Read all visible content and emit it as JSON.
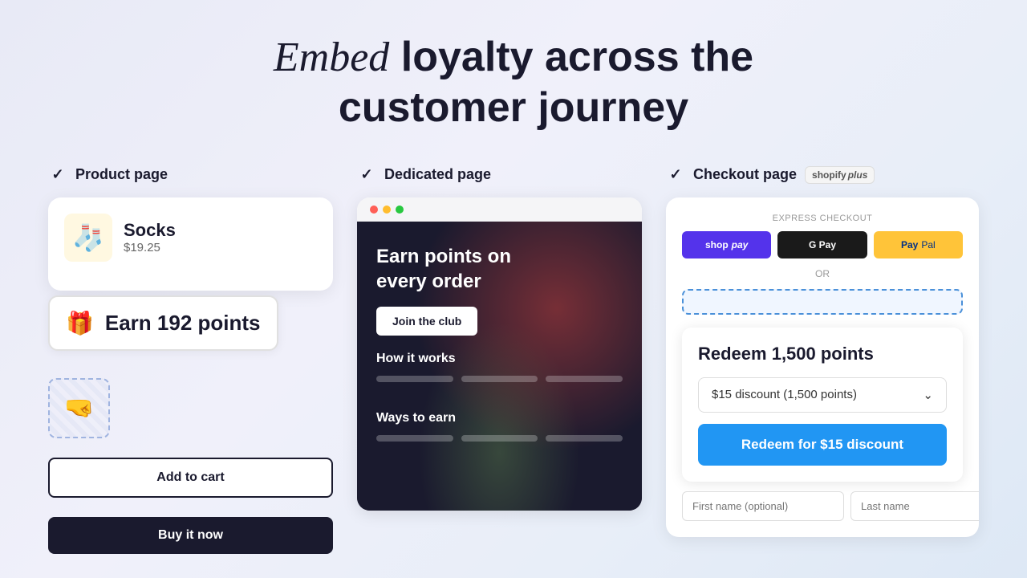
{
  "hero": {
    "title_normal": "Embed",
    "title_bold": "loyalty across the customer journey"
  },
  "columns": [
    {
      "id": "product-page",
      "label": "Product page",
      "has_shopify_plus": false,
      "product": {
        "name": "Socks",
        "price": "$19.25",
        "emoji": "🧦"
      },
      "earn_banner": {
        "text": "Earn 192 points",
        "icon": "🎁"
      },
      "add_to_cart_label": "Add to cart",
      "buy_now_label": "Buy it now"
    },
    {
      "id": "dedicated-page",
      "label": "Dedicated page",
      "has_shopify_plus": false,
      "headline": "Earn points on every order",
      "join_label": "Join the club",
      "how_it_works": "How it works",
      "ways_to_earn": "Ways to earn"
    },
    {
      "id": "checkout-page",
      "label": "Checkout page",
      "has_shopify_plus": true,
      "shopify_plus_text": "shopify",
      "shopify_plus_suffix": "plus",
      "express_checkout": "Express checkout",
      "or_text": "OR",
      "shop_pay": "shop pay",
      "google_pay": "G Pay",
      "paypal": "PayPal",
      "redeem": {
        "title": "Redeem 1,500 points",
        "discount_option": "$15 discount (1,500 points)",
        "button_label": "Redeem for $15 discount"
      },
      "form": {
        "first_name_placeholder": "First name (optional)",
        "last_name_placeholder": "Last name"
      }
    }
  ]
}
